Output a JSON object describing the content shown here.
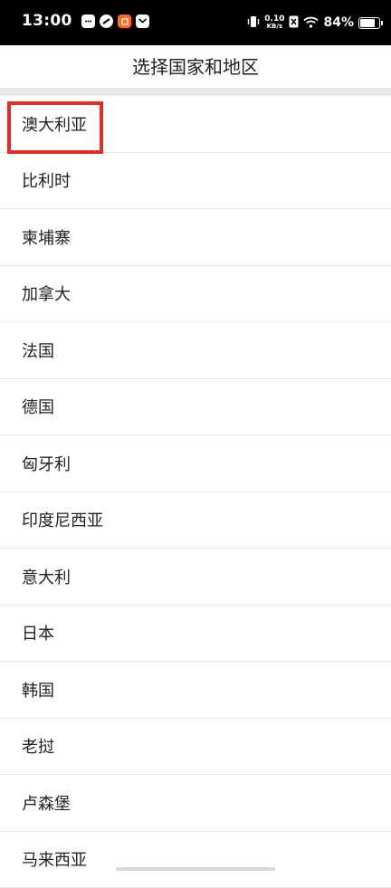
{
  "status_bar": {
    "time": "13:00",
    "net_speed_value": "0.10",
    "net_speed_unit": "KB/s",
    "battery_percent": "84%",
    "battery_level": 0.84,
    "left_icons": [
      "chat-bubble-icon",
      "link-icon",
      "shop-icon",
      "mail-icon"
    ],
    "right_icons": [
      "vibrate-icon",
      "sim-x-icon",
      "wifi-icon",
      "battery-icon"
    ]
  },
  "header": {
    "title": "选择国家和地区"
  },
  "countries": [
    "澳大利亚",
    "比利时",
    "柬埔寨",
    "加拿大",
    "法国",
    "德国",
    "匈牙利",
    "印度尼西亚",
    "意大利",
    "日本",
    "韩国",
    "老挝",
    "卢森堡",
    "马来西亚"
  ],
  "highlighted_country": "澳大利亚",
  "colors": {
    "highlight": "#e52d27",
    "status_bar_bg": "#000000",
    "divider": "#e9e9ec"
  }
}
